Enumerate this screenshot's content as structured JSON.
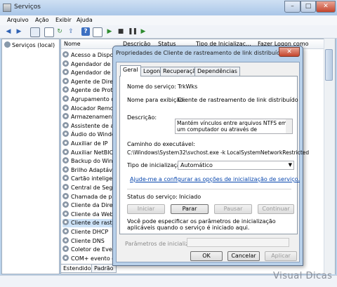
{
  "window": {
    "title": "Serviços"
  },
  "menu": [
    "Arquivo",
    "Ação",
    "Exibir",
    "Ajuda"
  ],
  "tree": {
    "root": "Serviços (local)"
  },
  "list": {
    "columns": [
      "Nome",
      "Descrição",
      "Status",
      "Tipo de Inicializaç...",
      "Fazer Logon como"
    ],
    "services": [
      "Acesso a Disposit",
      "Agendador de Cla",
      "Agendador de Ta",
      "Agente de Diretiv",
      "Agente de Proteç",
      "Agrupamento de",
      "Alocador Remote",
      "Armazenamento",
      "Assistente de aqu",
      "Áudio do Window",
      "Auxiliar de IP",
      "Auxiliar NetBIOS T",
      "Backup do Windo",
      "Brilho Adaptável",
      "Cartão inteligente",
      "Central de Segura",
      "Chamada de proc",
      "Cliente da Diretiv",
      "Cliente da Web",
      "Cliente de rastrea",
      "Cliente DHCP",
      "Cliente DNS",
      "Coletor de Evento",
      "COM+ evento do"
    ],
    "selected_index": 19
  },
  "bottom_tabs": [
    "Estendido",
    "Padrão"
  ],
  "dialog": {
    "title": "Propriedades de Cliente de rastreamento de link distribuído (Co...",
    "tabs": [
      "Geral",
      "Logon",
      "Recuperação",
      "Dependências"
    ],
    "active_tab": "Geral",
    "service_name_label": "Nome do serviço:",
    "service_name": "TrkWks",
    "display_name_label": "Nome para exibição:",
    "display_name": "Cliente de rastreamento de link distribuído",
    "description_label": "Descrição:",
    "description": "Mantém vínculos entre arquivos NTFS em um computador ou através de computadores em uma",
    "exe_path_label": "Caminho do executável:",
    "exe_path": "C:\\Windows\\System32\\svchost.exe -k LocalSystemNetworkRestricted",
    "startup_type_label": "Tipo de inicialização:",
    "startup_type": "Automático",
    "help_link": "Ajude-me a configurar as opções de inicialização de serviço.",
    "status_label": "Status do serviço:",
    "status_value": "Iniciado",
    "btn_start": "Iniciar",
    "btn_stop": "Parar",
    "btn_pause": "Pausar",
    "btn_continue": "Continuar",
    "params_help": "Você pode especificar os parâmetros de inicialização aplicáveis quando o serviço é iniciado aqui.",
    "params_label": "Parâmetros de inicialização:",
    "params_value": "",
    "btn_ok": "OK",
    "btn_cancel": "Cancelar",
    "btn_apply": "Aplicar"
  },
  "watermark": "Visual Dicas"
}
